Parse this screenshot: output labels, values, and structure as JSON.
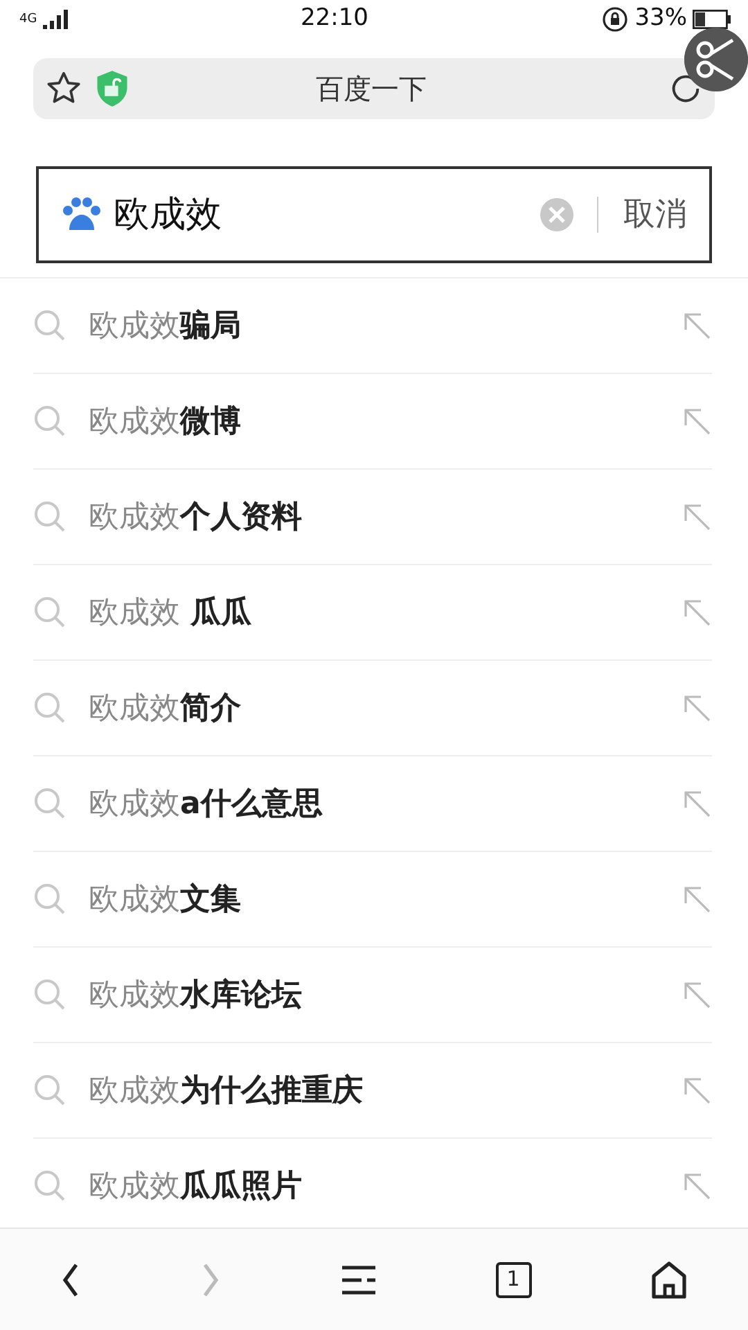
{
  "status_bar": {
    "network": "4G",
    "time": "22:10",
    "battery": "33%"
  },
  "address_bar": {
    "title": "百度一下",
    "bookmarked": false,
    "secure": true
  },
  "search": {
    "value": "欧成效",
    "cancel": "取消"
  },
  "suggestions": [
    {
      "query": "欧成效",
      "suffix": "骗局"
    },
    {
      "query": "欧成效",
      "suffix": "微博"
    },
    {
      "query": "欧成效",
      "suffix": "个人资料"
    },
    {
      "query": "欧成效",
      "suffix": " 瓜瓜"
    },
    {
      "query": "欧成效",
      "suffix": "简介"
    },
    {
      "query": "欧成效",
      "suffix": "a什么意思"
    },
    {
      "query": "欧成效",
      "suffix": "文集"
    },
    {
      "query": "欧成效",
      "suffix": "水库论坛"
    },
    {
      "query": "欧成效",
      "suffix": "为什么推重庆"
    },
    {
      "query": "欧成效",
      "suffix": "瓜瓜照片"
    }
  ],
  "toolbar": {
    "back_disabled": false,
    "forward_disabled": true,
    "tab_count": "1"
  }
}
